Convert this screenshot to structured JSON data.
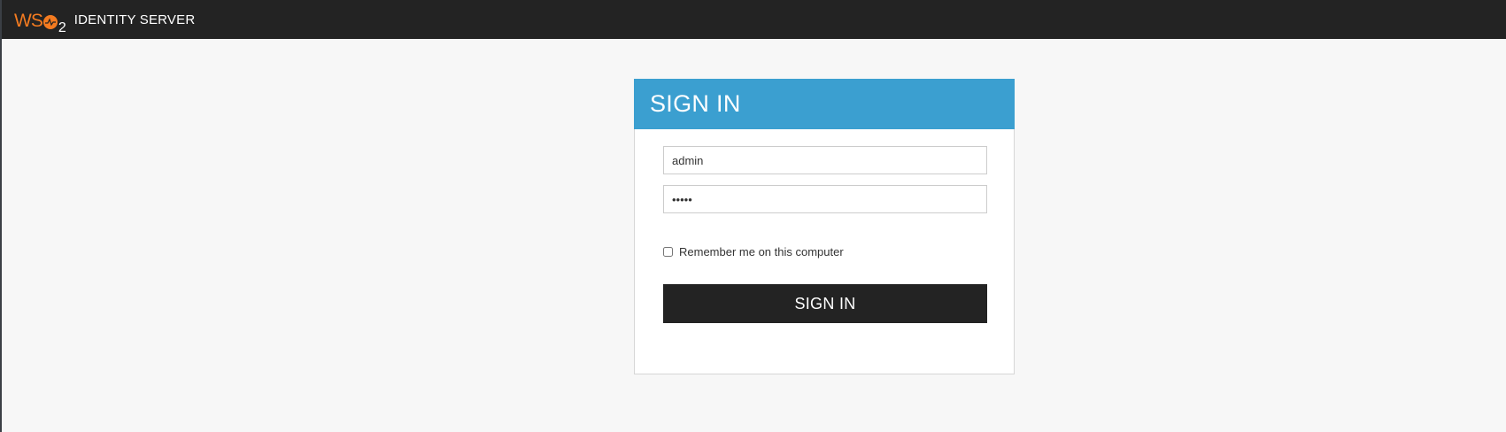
{
  "header": {
    "logo_text": "WSO2",
    "logo_letters": "WS",
    "logo_subscript": "2",
    "product_name": "IDENTITY SERVER",
    "brand_color": "#f47b20",
    "bar_color": "#232323"
  },
  "login": {
    "title": "SIGN IN",
    "header_color": "#3b9fd0",
    "username": {
      "value": "admin"
    },
    "password": {
      "value": "admin"
    },
    "remember": {
      "label": "Remember me on this computer",
      "checked": false
    },
    "submit_label": "SIGN IN"
  }
}
